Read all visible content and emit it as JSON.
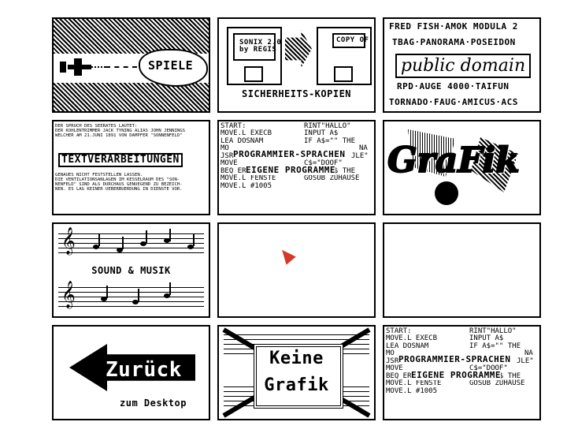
{
  "tiles": {
    "games": {
      "label": "SPIELE"
    },
    "backup": {
      "label": "SICHERHEITS-KOPIEN",
      "disk1": "SONIX 2.0\nby REGIS",
      "disk2": "COPY OF"
    },
    "public_domain": {
      "line1": "FRED FISH·AMOK MODULA 2",
      "line2": "TBAG·PANORAMA·POSEIDON",
      "title": "public domain",
      "line3": "RPD·AUGE 4000·TAIFUN",
      "line4": "TORNADO·FAUG·AMICUS·ACS"
    },
    "text": {
      "lines_top": [
        "DER SPRUCH DES SEERATES LAUTET:",
        "DER KOHLENTRIMMER JACK TYNING ALIAS JOHN JENNINGS",
        "WELCHER AM 21.JUNI 1891 VON DAMPFER \"SONNENFELD\""
      ],
      "title": "TEXTVERARBEITUNGEN",
      "lines_bottom": [
        "GENAUES NICHT FESTSTELLEN LASSEN.",
        "DIE VENTILATIONSANLAGEN IM KESSELRAUM DES \"SON-",
        "NENFELD\" SIND ALS DURCHAUS GENUEGEND ZU BEZEICH-",
        "NEN.   ES LAG KEINER UEBERBUERDUNG IN DIENSTE VOR."
      ]
    },
    "programs": {
      "code_left": [
        "START:",
        "MOVE.L EXECB",
        "LEA    DOSNAM",
        "MO",
        "JSR",
        "MOVE",
        "BEQ    ERROR",
        "MOVE.L FENSTE",
        "MOVE.L #1005"
      ],
      "code_right": [
        "RINT\"HALLO\"",
        "INPUT A$",
        "IF A$=\"\" THE",
        "NA",
        "JLE\"",
        "C$=\"DOOF\"",
        "IF B$=C$ THE",
        "GOSUB ZUHAUSE"
      ],
      "title1": "PROGRAMMIER-SPRACHEN",
      "title2": "EIGENE PROGRAMME"
    },
    "graphics": {
      "label": "GraFik"
    },
    "music": {
      "label": "SOUND & MUSIK"
    },
    "back": {
      "label": "Zurück",
      "sub": "zum Desktop"
    },
    "nographics": {
      "label1": "Keine",
      "label2": "Grafik"
    }
  }
}
